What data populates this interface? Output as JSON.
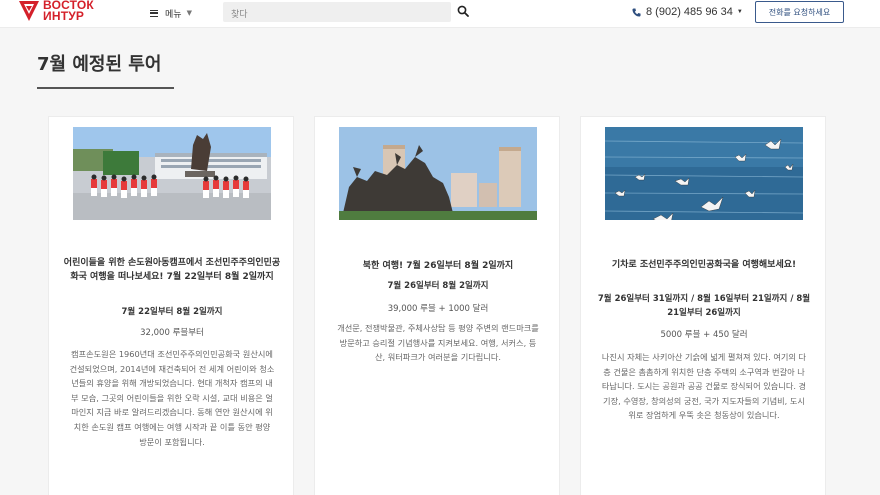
{
  "header": {
    "logo": {
      "line1": "ВОСТОК",
      "line2": "ИНТУР"
    },
    "menu_label": "메뉴",
    "search_placeholder": "찾다",
    "phone": "8 (902) 485 96 34",
    "call_button": "전화를 요청하세요"
  },
  "section": {
    "title": "7월 예정된 투어"
  },
  "cards": [
    {
      "title": "어린이들을 위한 손도원아동캠프에서 조선민주주의인민공화국 여행을 떠나보세요! 7월 22일부터 8월 2일까지",
      "dates": "7월 22일부터 8월 2일까지",
      "price": "32,000 루블부터",
      "description": "캠프손도원은 1960년대 조선민주주의인민공화국 원산시에 건설되었으며, 2014년에 재건축되어 전 세계 어린이와 청소년들의 휴양을 위해 개방되었습니다. 현대 개척자 캠프의 내부 모습, 그곳의 어린이들을 위한 오락 시설, 교대 비용은 얼마인지 지금 바로 알려드리겠습니다. 동해 연안 원산시에 위치한 손도원 캠프 여행에는 여행 시작과 끝 이틀 동안 평양 방문이 포함됩니다."
    },
    {
      "title": "북한 여행! 7월 26일부터 8월 2일까지",
      "dates": "7월 26일부터 8월 2일까지",
      "price": "39,000 루블 + 1000 달러",
      "description": "개선문, 전쟁박물관, 주체사상탑 등 평양 주변의 랜드마크를 방문하고 승리절 기념행사를 지켜보세요. 여행, 서커스, 등산, 워터파크가 여러분을 기다립니다."
    },
    {
      "title": "기차로 조선민주주의인민공화국을 여행해보세요!",
      "dates": "7월 26일부터 31일까지 / 8월 16일부터 21일까지 / 8월 21일부터 26일까지",
      "price": "5000 루블 + 450 달러",
      "description": "나진시 자체는 사키아산 기슭에 넓게 펼쳐져 있다. 여기의 다층 건물은 촘촘하게 위치한 단층 주택의 소구역과 번갈아 나타납니다. 도시는 공원과 공공 건물로 장식되어 있습니다. 경기장, 수영장, 창의성의 궁전, 국가 지도자들의 기념비, 도시 위로 장엄하게 우뚝 솟은 청동상이 있습니다."
    }
  ],
  "colors": {
    "brand_red": "#d4202a",
    "button_border": "#3a5a8c",
    "page_background": "#f6f6f6"
  },
  "icons": [
    "logo-icon",
    "menu-icon",
    "chevron-down-icon",
    "search-icon",
    "phone-icon",
    "caret-down-icon"
  ]
}
